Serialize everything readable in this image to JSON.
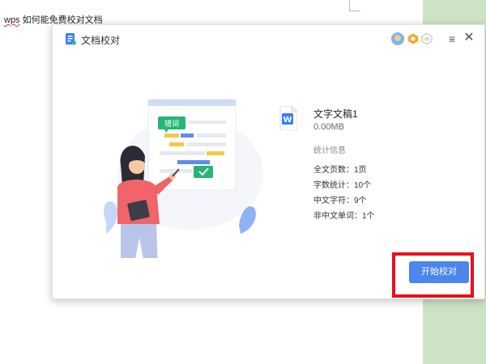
{
  "document": {
    "text_spell": "wps",
    "text_rest": " 如何能免费校对文档"
  },
  "dialog": {
    "title": "文档校对",
    "menu_glyph": "≡",
    "close_glyph": "✕",
    "illustration": {
      "tag_label": "错词"
    },
    "file": {
      "name": "文字文稿1",
      "size": "0.00MB"
    },
    "stats": {
      "title": "统计信息",
      "rows": [
        "全文页数：1页",
        "字数统计：10个",
        "中文字符：9个",
        "非中文单词：1个"
      ]
    },
    "start_button_label": "开始校对"
  },
  "colors": {
    "accent": "#4a86ee",
    "highlight": "#e8101a",
    "tag_green": "#27b573",
    "background_green": "#cde3c6"
  }
}
